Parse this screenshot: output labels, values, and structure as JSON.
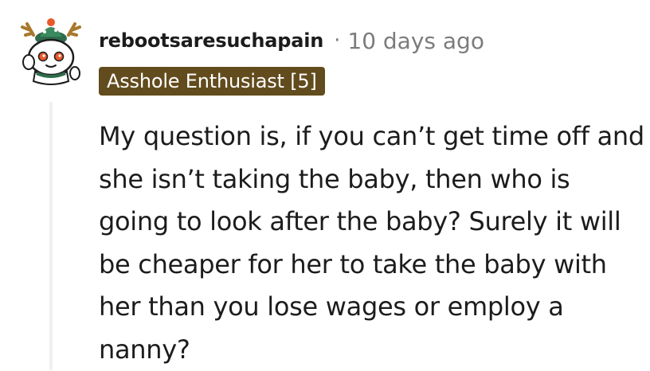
{
  "comment": {
    "author": "rebootsaresuchapain",
    "separator": "·",
    "timestamp": "10 days ago",
    "flair": "Asshole Enthusiast [5]",
    "body": "My question is, if you can’t get time off and she isn’t taking the baby, then who is going to look after the baby? Surely it will be cheaper for her to take the baby with her than you lose wages or employ a nanny?"
  },
  "avatar": {
    "icon": "snoo-avatar-antlers-icon"
  },
  "colors": {
    "flair_background": "#624b1d",
    "flair_text": "#ffffff",
    "meta_text": "#7c7c7c",
    "thread_line": "#edeff1"
  }
}
